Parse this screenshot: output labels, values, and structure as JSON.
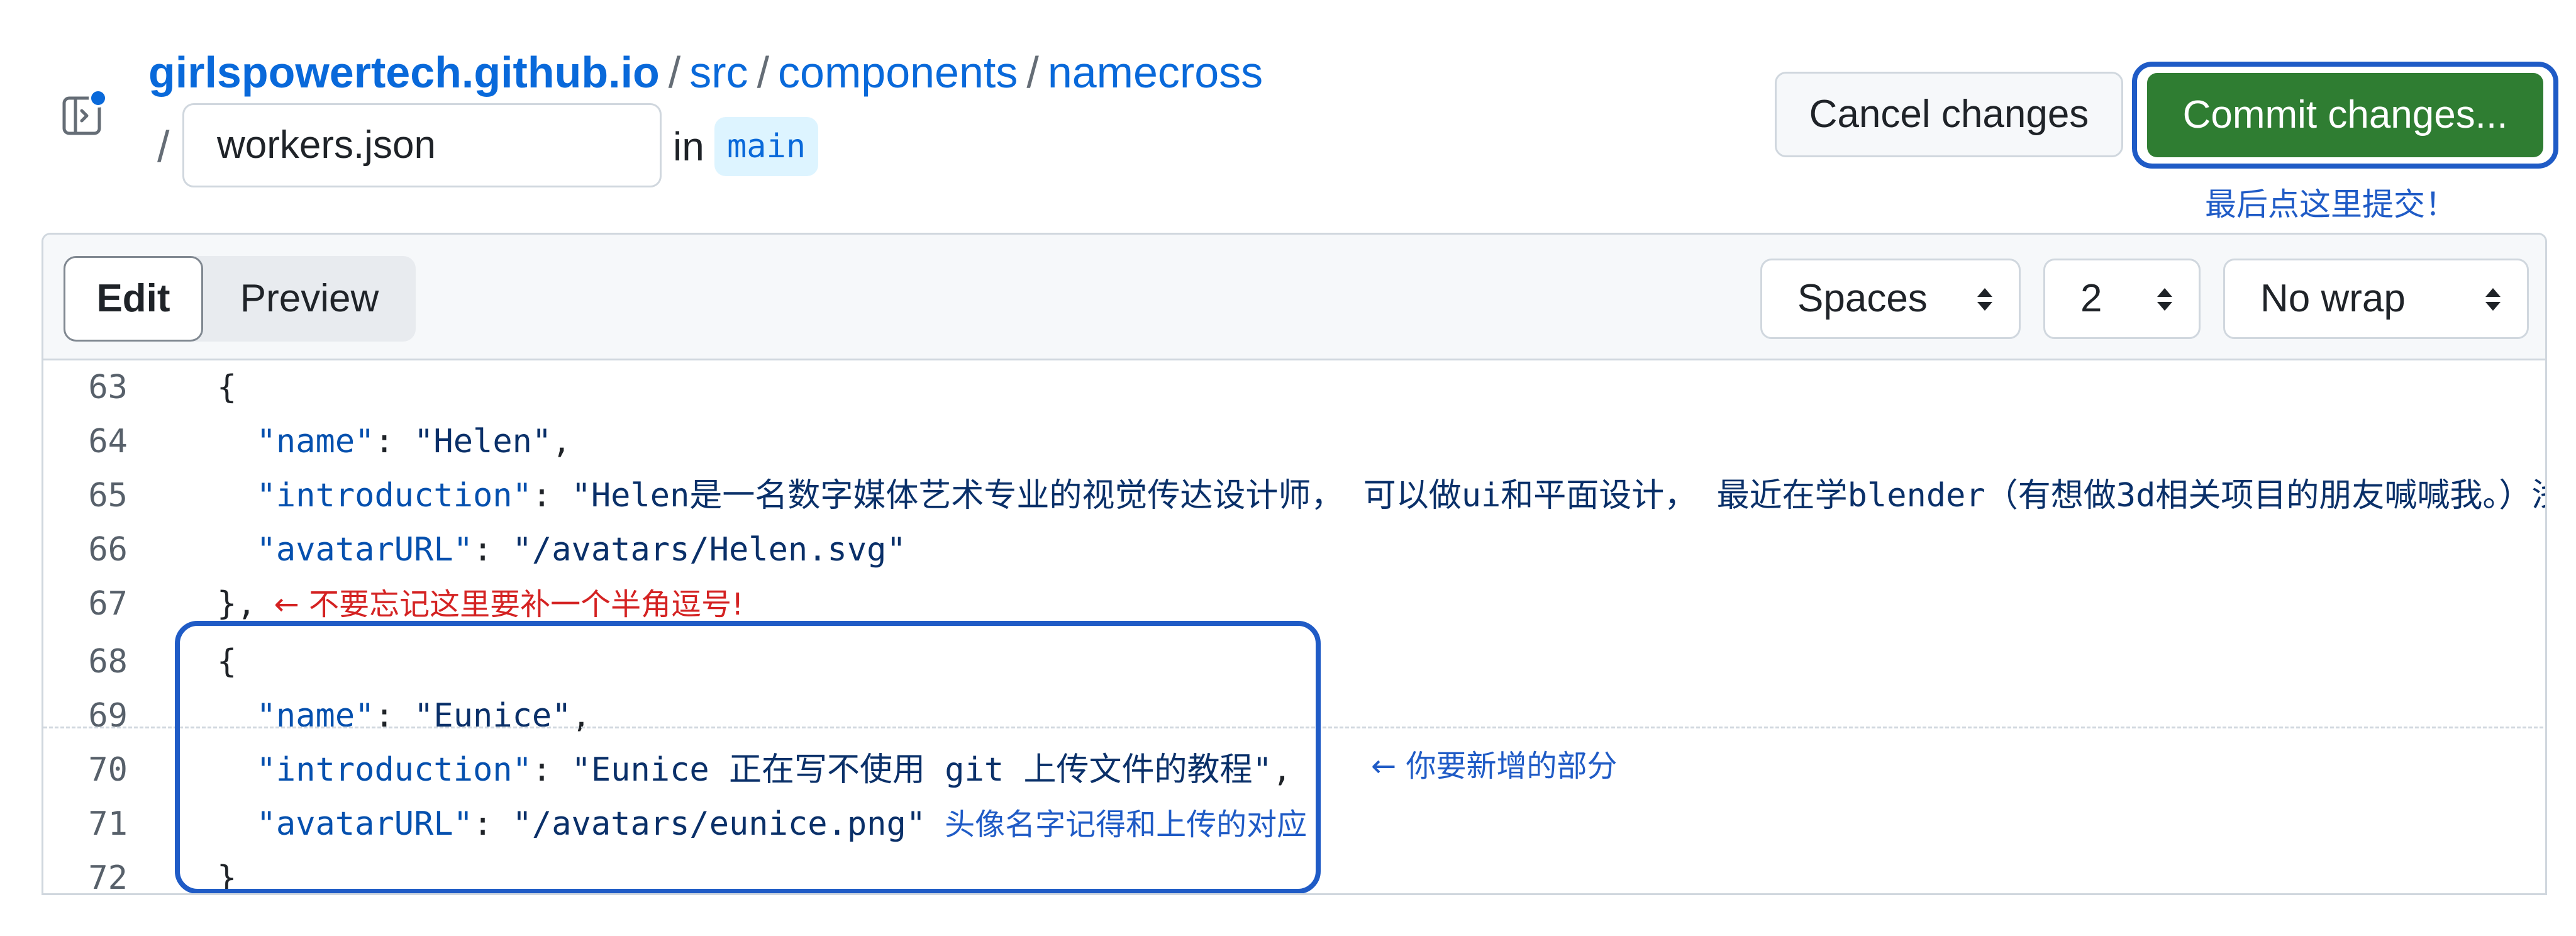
{
  "breadcrumb": {
    "repo": "girlspowertech.github.io",
    "path": [
      "src",
      "components",
      "namecross"
    ],
    "separator": "/"
  },
  "file": {
    "name": "workers.json",
    "in_label": "in",
    "branch": "main"
  },
  "actions": {
    "cancel_label": "Cancel changes",
    "commit_label": "Commit changes...",
    "commit_note": "最后点这里提交！"
  },
  "editor": {
    "tabs": [
      "Edit",
      "Preview"
    ],
    "indent_mode": "Spaces",
    "indent_size": "2",
    "wrap_mode": "No wrap",
    "lines": [
      {
        "n": "63",
        "parts": [
          {
            "t": "{",
            "c": "p"
          }
        ]
      },
      {
        "n": "64",
        "parts": [
          {
            "t": "  ",
            "c": "p"
          },
          {
            "t": "\"name\"",
            "c": "key"
          },
          {
            "t": ": ",
            "c": "p"
          },
          {
            "t": "\"Helen\"",
            "c": "str"
          },
          {
            "t": ",",
            "c": "p"
          }
        ]
      },
      {
        "n": "65",
        "parts": [
          {
            "t": "  ",
            "c": "p"
          },
          {
            "t": "\"introduction\"",
            "c": "key"
          },
          {
            "t": ": ",
            "c": "p"
          },
          {
            "t": "\"Helen是一名数字媒体艺术专业的视觉传达设计师， 可以做ui和平面设计， 最近在学blender（有想做3d相关项目的朋友喊喊我。）浅浅",
            "c": "str"
          }
        ]
      },
      {
        "n": "66",
        "parts": [
          {
            "t": "  ",
            "c": "p"
          },
          {
            "t": "\"avatarURL\"",
            "c": "key"
          },
          {
            "t": ": ",
            "c": "p"
          },
          {
            "t": "\"/avatars/Helen.svg\"",
            "c": "str"
          }
        ]
      },
      {
        "n": "67",
        "parts": [
          {
            "t": "},",
            "c": "p"
          }
        ],
        "note": "← 不要忘记这里要补一个半角逗号!"
      },
      {
        "n": "68",
        "parts": [
          {
            "t": "{",
            "c": "p"
          }
        ]
      },
      {
        "n": "69",
        "parts": [
          {
            "t": "  ",
            "c": "p"
          },
          {
            "t": "\"name\"",
            "c": "key"
          },
          {
            "t": ": ",
            "c": "p"
          },
          {
            "t": "\"Eunice\"",
            "c": "str"
          },
          {
            "t": ",",
            "c": "p"
          }
        ]
      },
      {
        "n": "70",
        "parts": [
          {
            "t": "  ",
            "c": "p"
          },
          {
            "t": "\"introduction\"",
            "c": "key"
          },
          {
            "t": ": ",
            "c": "p"
          },
          {
            "t": "\"Eunice 正在写不使用 git 上传文件的教程\"",
            "c": "str"
          },
          {
            "t": ",",
            "c": "p"
          }
        ]
      },
      {
        "n": "71",
        "parts": [
          {
            "t": "  ",
            "c": "p"
          },
          {
            "t": "\"avatarURL\"",
            "c": "key"
          },
          {
            "t": ": ",
            "c": "p"
          },
          {
            "t": "\"/avatars/eunice.png\"",
            "c": "str"
          }
        ],
        "note": "头像名字记得和上传的对应"
      },
      {
        "n": "72",
        "parts": [
          {
            "t": "}",
            "c": "p"
          }
        ]
      }
    ]
  },
  "annotations": {
    "new_section": "← 你要新增的部分"
  },
  "colors": {
    "link": "#0969da",
    "commit_button": "#2f7d32",
    "annotation_blue": "#1f5bc6",
    "annotation_red": "#d42222"
  },
  "icons": [
    "panel-toggle-icon",
    "select-arrows-icon"
  ]
}
